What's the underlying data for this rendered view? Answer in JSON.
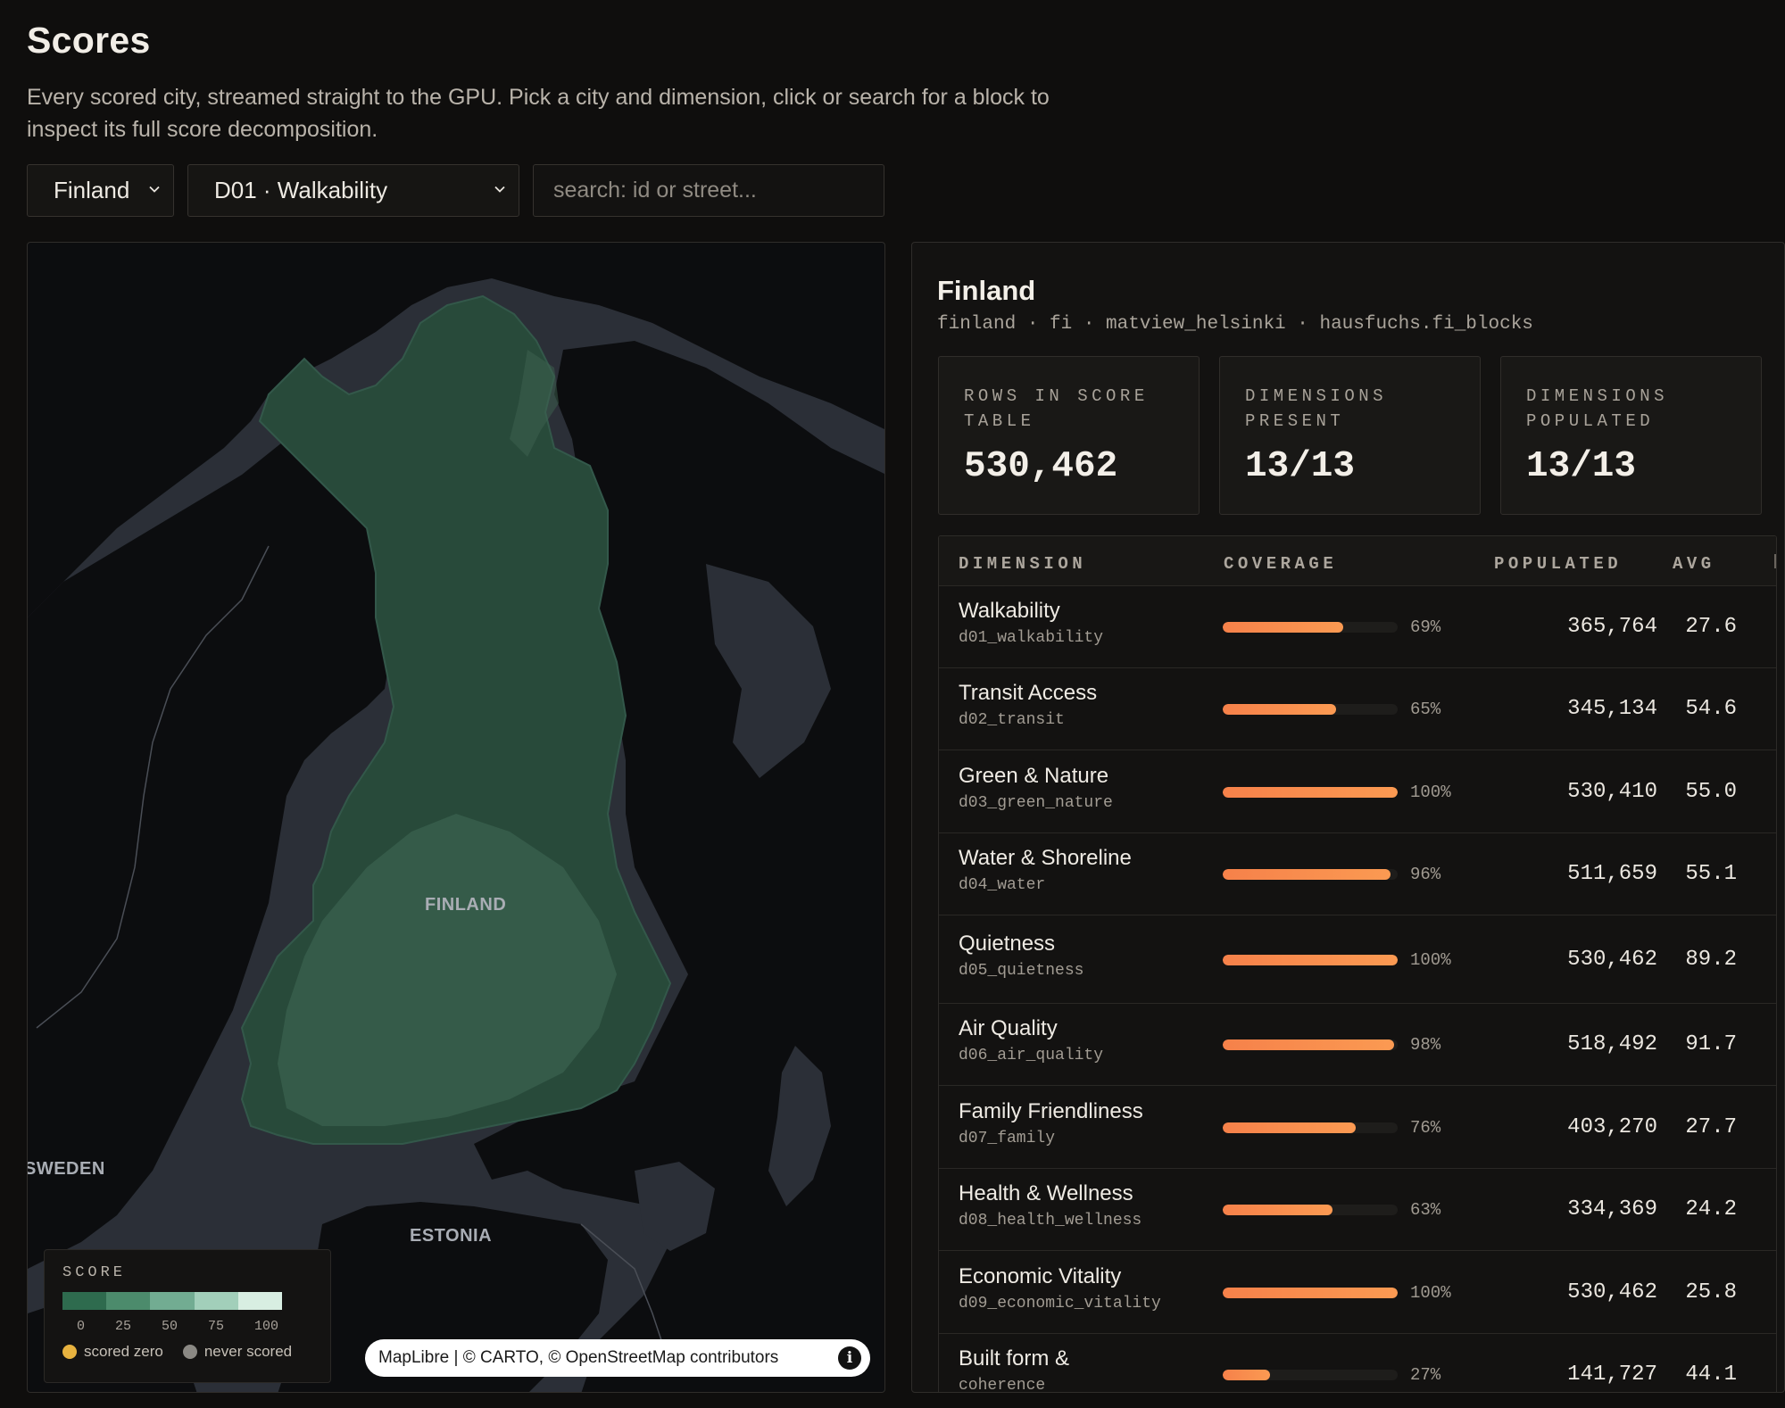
{
  "page": {
    "title": "Scores",
    "subtitle": "Every scored city, streamed straight to the GPU. Pick a city and dimension, click or search for a block to inspect its full score decomposition."
  },
  "controls": {
    "country": "Finland",
    "dimension": "D01 · Walkability",
    "search_placeholder": "search: id or street..."
  },
  "map": {
    "labels": {
      "finland": "FINLAND",
      "sweden": "SWEDEN",
      "estonia": "ESTONIA"
    },
    "legend": {
      "title": "SCORE",
      "ticks": [
        "0",
        "25",
        "50",
        "75",
        "100"
      ],
      "ramp_colors": [
        "#2e6b4e",
        "#4c8b6c",
        "#72ac92",
        "#a2cfba",
        "#d8eee2"
      ],
      "scored_zero": "scored zero",
      "never_scored": "never scored",
      "scored_zero_color": "#e7b23f",
      "never_scored_color": "#8b8984"
    },
    "attribution": "MapLibre | © CARTO, © OpenStreetMap contributors",
    "land_color": "#0c0d0f",
    "water_color": "#2b2f37",
    "finland_fill": "#284a3a"
  },
  "panel": {
    "title": "Finland",
    "meta": "finland · fi · matview_helsinki · hausfuchs.fi_blocks",
    "stats": [
      {
        "label": "ROWS IN SCORE TABLE",
        "value": "530,462"
      },
      {
        "label": "DIMENSIONS PRESENT",
        "value": "13/13"
      },
      {
        "label": "DIMENSIONS POPULATED",
        "value": "13/13"
      }
    ],
    "table": {
      "headers": {
        "dimension": "DIMENSION",
        "coverage": "COVERAGE",
        "populated": "POPULATED",
        "avg": "AVG"
      },
      "rows": [
        {
          "name": "Walkability",
          "code": "d01_walkability",
          "coverage": 69,
          "coverage_label": "69%",
          "populated": "365,764",
          "avg": "27.6"
        },
        {
          "name": "Transit Access",
          "code": "d02_transit",
          "coverage": 65,
          "coverage_label": "65%",
          "populated": "345,134",
          "avg": "54.6"
        },
        {
          "name": "Green & Nature",
          "code": "d03_green_nature",
          "coverage": 100,
          "coverage_label": "100%",
          "populated": "530,410",
          "avg": "55.0"
        },
        {
          "name": "Water & Shoreline",
          "code": "d04_water",
          "coverage": 96,
          "coverage_label": "96%",
          "populated": "511,659",
          "avg": "55.1"
        },
        {
          "name": "Quietness",
          "code": "d05_quietness",
          "coverage": 100,
          "coverage_label": "100%",
          "populated": "530,462",
          "avg": "89.2"
        },
        {
          "name": "Air Quality",
          "code": "d06_air_quality",
          "coverage": 98,
          "coverage_label": "98%",
          "populated": "518,492",
          "avg": "91.7"
        },
        {
          "name": "Family Friendliness",
          "code": "d07_family",
          "coverage": 76,
          "coverage_label": "76%",
          "populated": "403,270",
          "avg": "27.7"
        },
        {
          "name": "Health & Wellness",
          "code": "d08_health_wellness",
          "coverage": 63,
          "coverage_label": "63%",
          "populated": "334,369",
          "avg": "24.2"
        },
        {
          "name": "Economic Vitality",
          "code": "d09_economic_vitality",
          "coverage": 100,
          "coverage_label": "100%",
          "populated": "530,462",
          "avg": "25.8"
        },
        {
          "name": "Built form &",
          "code": "coherence",
          "coverage": 27,
          "coverage_label": "27%",
          "populated": "141,727",
          "avg": "44.1"
        }
      ]
    }
  }
}
